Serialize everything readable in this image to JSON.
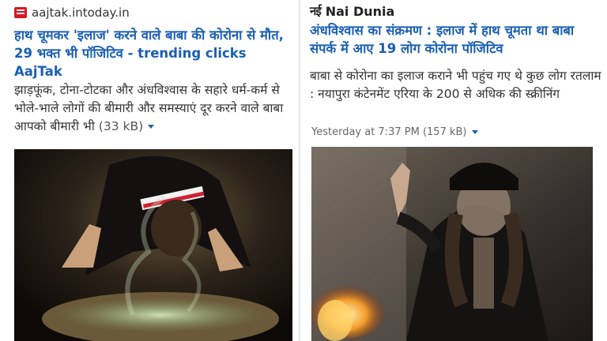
{
  "left": {
    "source": "aajtak.intoday.in",
    "headline": "हाथ चूमकर 'इलाज' करने वाले बाबा की कोरोना से मौत, 29 भक्त भी पॉजिटिव",
    "headline_suffix": " - trending clicks AajTak",
    "snippet": "झाड़फूंक, टोना-टोटका और अंधविश्वास के सहारे धर्म-कर्म से भोले-भाले लोगों की बीमारी और समस्याएं दूर करने वाले बाबा आपको बीमारी भी",
    "size": "(33 kB)",
    "icons": [
      "aajtak-logo-icon",
      "caret-down-icon"
    ],
    "colors": {
      "link": "#1a5fb4",
      "logo": "#d71920"
    }
  },
  "right": {
    "logo_text": "नई",
    "source": "Nai Dunia",
    "headline": "अंधविश्वास का संक्रमण : इलाज में हाथ चूमता था बाबा संपर्क में आए 19 लोग कोरोना पॉजिटिव",
    "snippet": "बाबा से कोरोना का इलाज कराने भी पहुंच गए थे कुछ लोग रतलाम : नयापुरा कंटेनमेंट एरिया के 200 से अधिक की स्क्रीनिंग",
    "meta": "Yesterday at 7:37 PM",
    "size": "(157 kB)",
    "icons": [
      "caret-down-icon"
    ]
  }
}
